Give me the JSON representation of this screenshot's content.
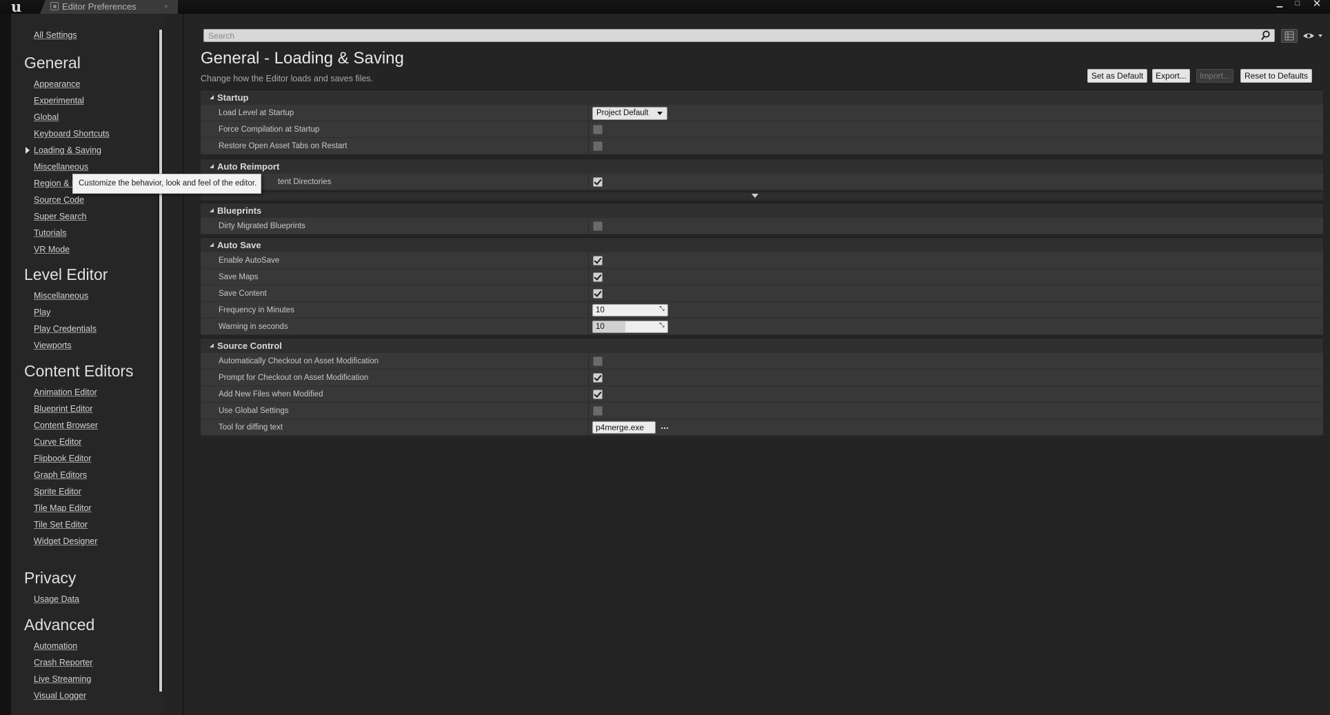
{
  "window": {
    "tab_title": "Editor Preferences",
    "tab_close": "×",
    "min": "▁",
    "max": "□",
    "close": "✕"
  },
  "icons": {
    "logo": "u",
    "search": "search-icon",
    "eye": "eye-icon",
    "table_view": "table-view-icon"
  },
  "nav": {
    "all_settings": "All Settings",
    "sections": [
      {
        "title": "General",
        "items": [
          "Appearance",
          "Experimental",
          "Global",
          "Keyboard Shortcuts",
          "Loading & Saving",
          "Miscellaneous",
          "Region & L",
          "Source Code",
          "Super Search",
          "Tutorials",
          "VR Mode"
        ]
      },
      {
        "title": "Level Editor",
        "items": [
          "Miscellaneous",
          "Play",
          "Play Credentials",
          "Viewports"
        ]
      },
      {
        "title": "Content Editors",
        "items": [
          "Animation Editor",
          "Blueprint Editor",
          "Content Browser",
          "Curve Editor",
          "Flipbook Editor",
          "Graph Editors",
          "Sprite Editor",
          "Tile Map Editor",
          "Tile Set Editor",
          "Widget Designer"
        ]
      },
      {
        "title": "Privacy",
        "items": [
          "Usage Data"
        ]
      },
      {
        "title": "Advanced",
        "items": [
          "Automation",
          "Crash Reporter",
          "Live Streaming",
          "Visual Logger"
        ]
      }
    ],
    "active_item": "Loading & Saving",
    "tooltip": "Customize the behavior, look and feel of the editor."
  },
  "search": {
    "placeholder": "Search"
  },
  "header": {
    "title": "General - Loading & Saving",
    "subtitle": "Change how the Editor loads and saves files.",
    "buttons": {
      "set_default": "Set as Default",
      "export": "Export...",
      "import": "Import...",
      "reset": "Reset to Defaults"
    }
  },
  "categories": {
    "startup": {
      "title": "Startup",
      "load_level": {
        "label": "Load Level at Startup",
        "value": "Project Default"
      },
      "force_compilation": {
        "label": "Force Compilation at Startup",
        "checked": false
      },
      "restore_tabs": {
        "label": "Restore Open Asset Tabs on Restart",
        "checked": false
      }
    },
    "auto_reimport": {
      "title": "Auto Reimport",
      "monitor_dirs": {
        "label": "tent Directories",
        "checked": true
      }
    },
    "blueprints": {
      "title": "Blueprints",
      "dirty_migrated": {
        "label": "Dirty Migrated Blueprints",
        "checked": false
      }
    },
    "auto_save": {
      "title": "Auto Save",
      "enable": {
        "label": "Enable AutoSave",
        "checked": true
      },
      "save_maps": {
        "label": "Save Maps",
        "checked": true
      },
      "save_content": {
        "label": "Save Content",
        "checked": true
      },
      "frequency": {
        "label": "Frequency in Minutes",
        "value": "10",
        "fill_fraction": 0
      },
      "warning": {
        "label": "Warning in seconds",
        "value": "10",
        "fill_fraction": 0.5
      }
    },
    "source_control": {
      "title": "Source Control",
      "auto_checkout": {
        "label": "Automatically Checkout on Asset Modification",
        "checked": false
      },
      "prompt_checkout": {
        "label": "Prompt for Checkout on Asset Modification",
        "checked": true
      },
      "add_new_files": {
        "label": "Add New Files when Modified",
        "checked": true
      },
      "use_global": {
        "label": "Use Global Settings",
        "checked": false
      },
      "diff_tool": {
        "label": "Tool for diffing text",
        "value": "p4merge.exe",
        "browse": "..."
      }
    }
  },
  "colors": {
    "background": "#242424",
    "row": "#383838",
    "header": "#2f2f2f",
    "accent_light": "#e6e6e6"
  }
}
